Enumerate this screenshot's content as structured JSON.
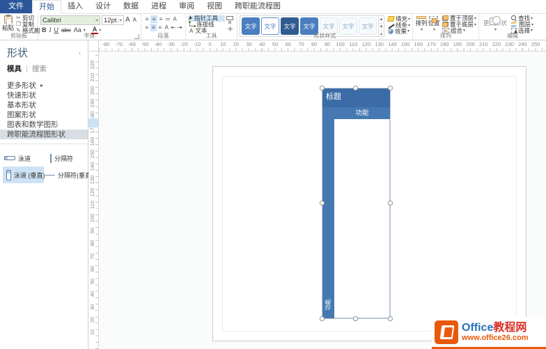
{
  "colors": {
    "accent": "#2b579a",
    "shape_title_blue": "#3c6ca6",
    "shape_band_blue": "#4679b1",
    "selection_blue": "#cde3f5",
    "watermark_orange": "#e8590c",
    "watermark_red": "#d93025",
    "watermark_blue": "#2a6fbb"
  },
  "ribbon": {
    "tabs": [
      {
        "label": "文件",
        "file": true
      },
      {
        "label": "开始",
        "active": true
      },
      {
        "label": "插入"
      },
      {
        "label": "设计"
      },
      {
        "label": "数据"
      },
      {
        "label": "进程"
      },
      {
        "label": "审阅"
      },
      {
        "label": "视图"
      },
      {
        "label": "跨职能流程图"
      }
    ],
    "clipboard": {
      "label": "剪贴板",
      "paste": "粘贴",
      "cut": "剪切",
      "copy": "复制",
      "painter": "格式刷",
      "cut_icon": "✂"
    },
    "font": {
      "label": "字体",
      "family": "Calibri",
      "size": "12pt",
      "grow": "A",
      "shrink": "A",
      "bold": "B",
      "italic": "I",
      "underline": "U",
      "strikethrough": "abc",
      "case_btn": "Aa",
      "color_btn": "A"
    },
    "paragraph": {
      "label": "段落",
      "rotate_icon": "A",
      "vtext_icon": "A"
    },
    "tools": {
      "label": "工具",
      "pointer": "指针工具",
      "connector": "连接线",
      "text": "文本",
      "x_icon": "✕"
    },
    "shape_styles": {
      "label": "形状样式",
      "fill": "填充",
      "line": "线条",
      "effects": "效果",
      "swatches": [
        {
          "label": "文字",
          "variant": "filled"
        },
        {
          "label": "文字",
          "variant": "outline"
        },
        {
          "label": "文字",
          "variant": "dark"
        },
        {
          "label": "文字",
          "variant": "filled"
        },
        {
          "label": "文字",
          "variant": "light"
        },
        {
          "label": "文字",
          "variant": "light"
        },
        {
          "label": "文字",
          "variant": "light"
        }
      ]
    },
    "arrange": {
      "label": "排列",
      "arrange": "排列",
      "position": "位置",
      "bring_front": "置于顶层",
      "send_back": "置于底层",
      "group": "组合"
    },
    "editing": {
      "label": "编辑",
      "change_shape": "更改形状",
      "find": "查找",
      "layers": "图层",
      "select": "选择"
    }
  },
  "shapes_panel": {
    "title": "形状",
    "tab_stencils": "模具",
    "tab_search": "搜索",
    "items": [
      {
        "label": "更多形状",
        "more": true
      },
      {
        "label": "快速形状"
      },
      {
        "label": "基本形状"
      },
      {
        "label": "图案形状"
      },
      {
        "label": "图表和数学图形"
      },
      {
        "label": "跨职能流程图形状",
        "active": true
      }
    ],
    "stencil_shapes": [
      {
        "label": "泳道",
        "icon": "swimlane-h"
      },
      {
        "label": "分隔符",
        "icon": "separator-v"
      },
      {
        "label": "泳道 (垂直)",
        "icon": "swimlane-v",
        "selected": true
      },
      {
        "label": "分隔符(垂直)",
        "icon": "separator-h"
      }
    ]
  },
  "canvas": {
    "ruler_h": [
      -80,
      -70,
      -60,
      -50,
      -40,
      -30,
      -20,
      -10,
      0,
      10,
      20,
      30,
      40,
      50,
      60,
      70,
      80,
      90,
      100,
      110,
      120,
      130,
      140,
      150,
      160,
      170,
      180,
      190,
      200,
      210,
      220,
      230,
      240,
      250
    ],
    "ruler_v": [
      220,
      210,
      200,
      190,
      180,
      170,
      160,
      150,
      140,
      130,
      120,
      110,
      100,
      90,
      80,
      70,
      60,
      50,
      40,
      30,
      20,
      10
    ],
    "swimlane": {
      "title": "标题",
      "lane_header": "功能",
      "side_label": "功能"
    }
  },
  "watermark": {
    "name_en": "Office",
    "name_zh": "教程网",
    "url": "www.office26.com"
  }
}
